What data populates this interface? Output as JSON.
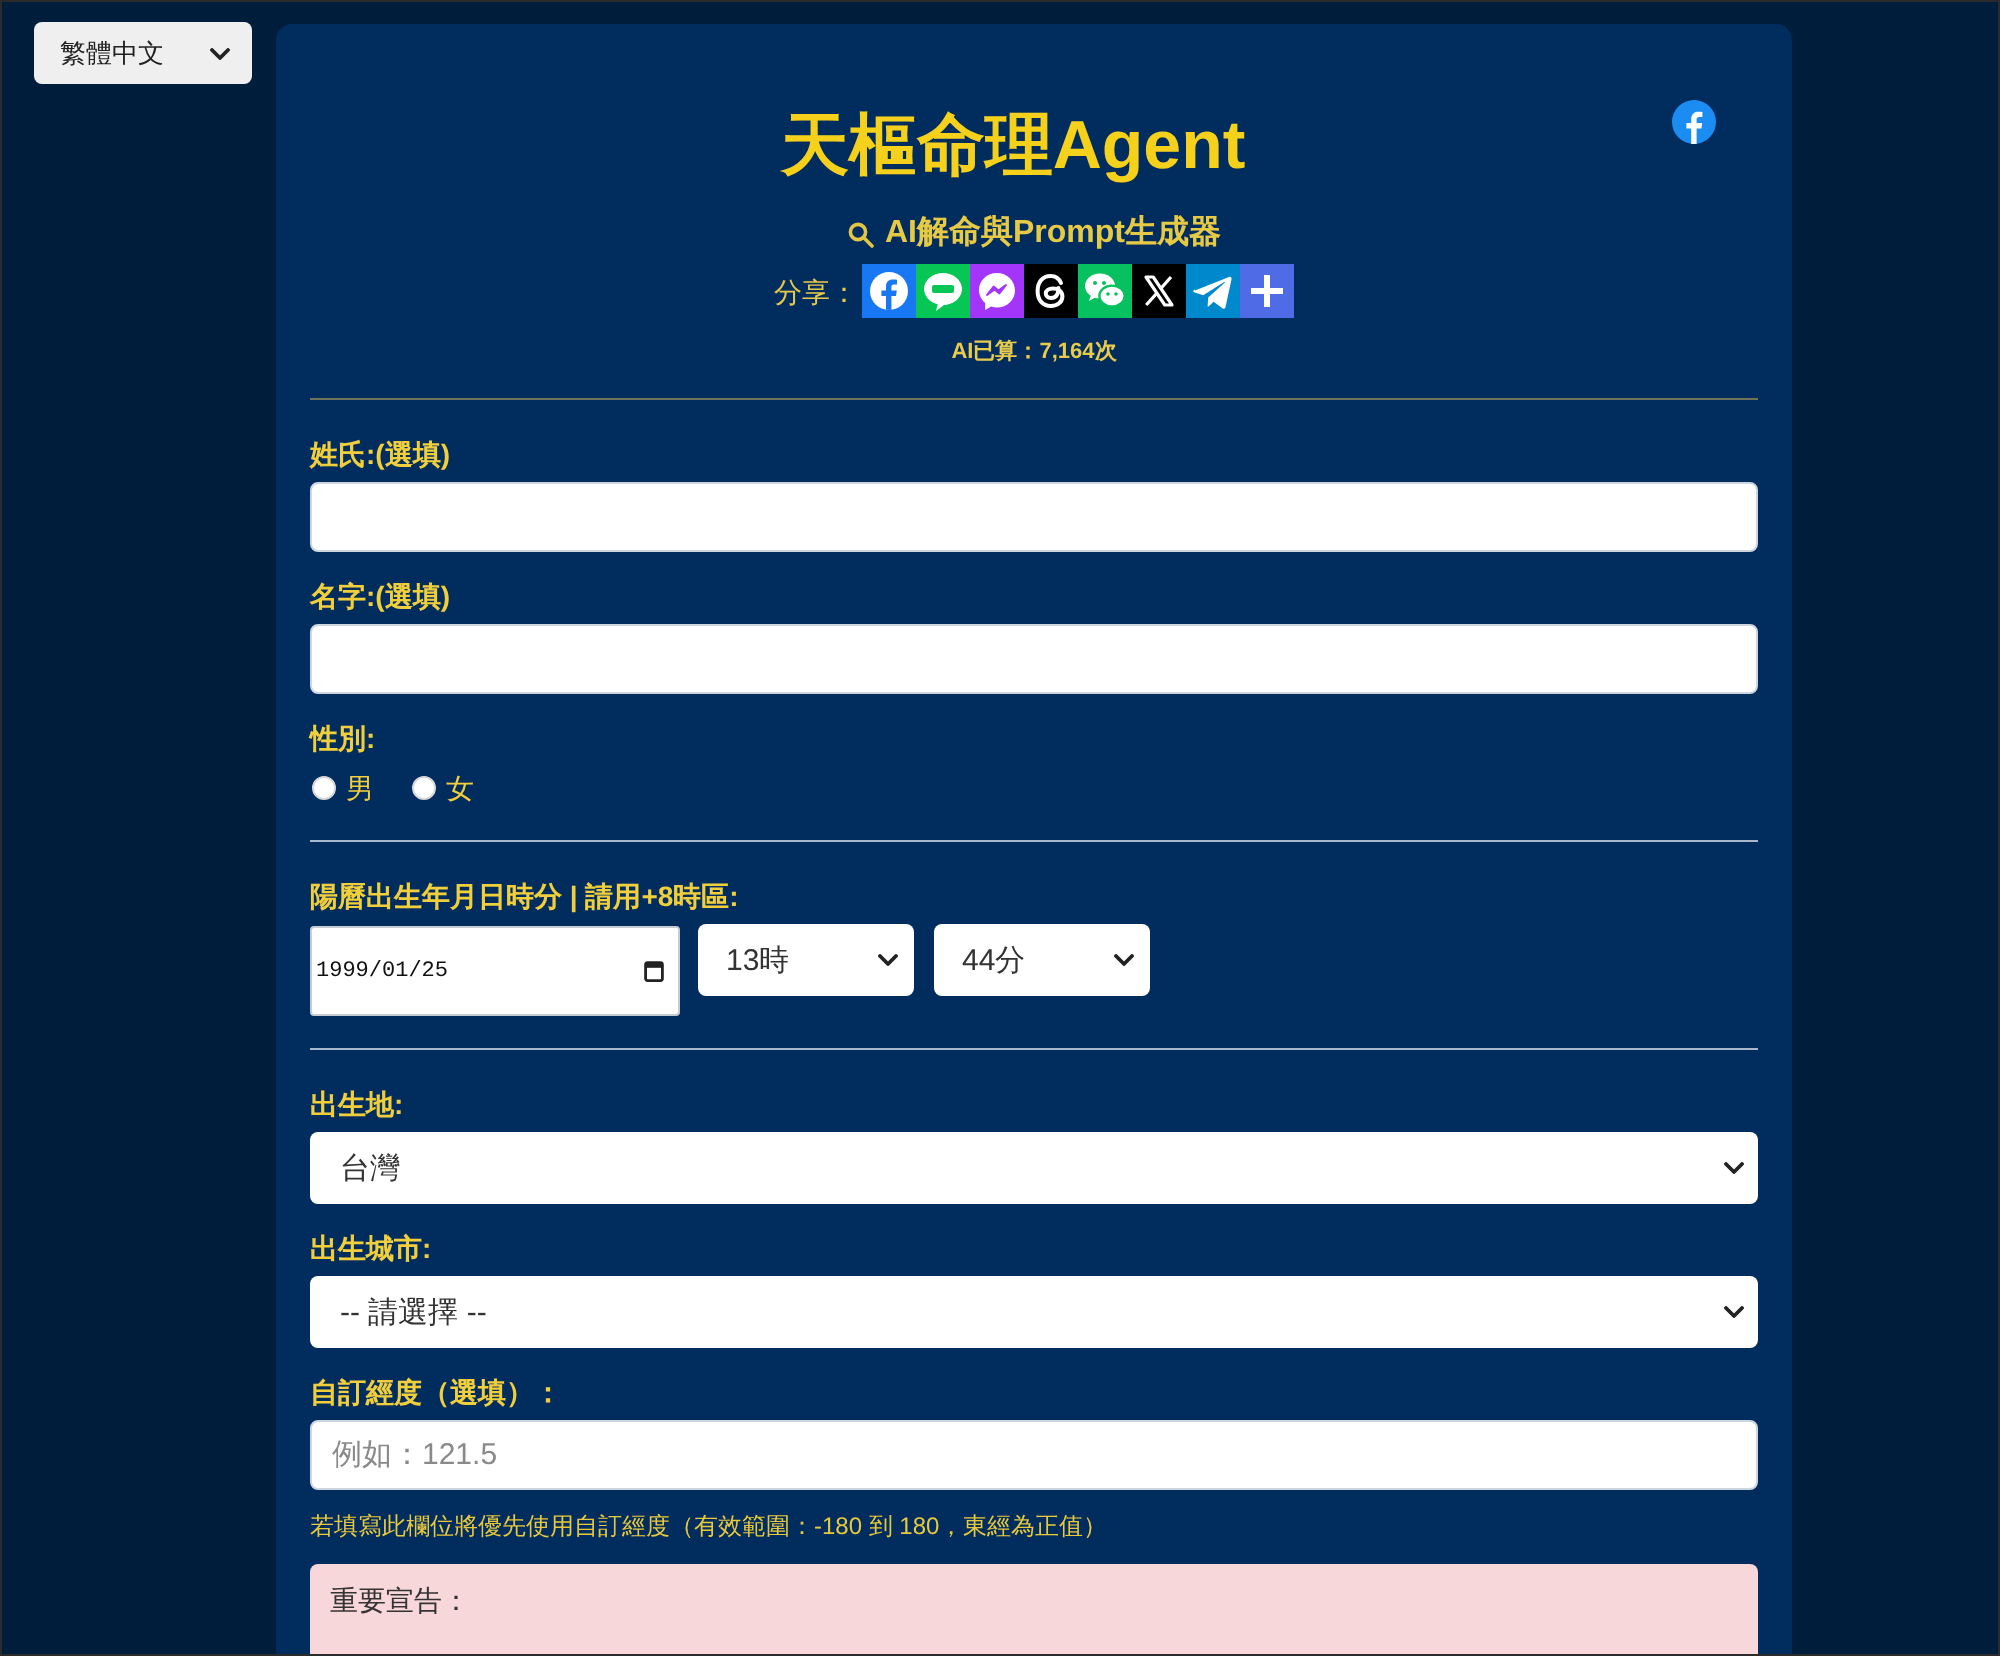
{
  "language_select": {
    "value": "繁體中文"
  },
  "header": {
    "title": "天樞命理Agent",
    "subtitle": "AI解命與Prompt生成器",
    "share_label": "分享：",
    "share_buttons": [
      {
        "kind": "facebook"
      },
      {
        "kind": "line"
      },
      {
        "kind": "messenger"
      },
      {
        "kind": "threads"
      },
      {
        "kind": "wechat"
      },
      {
        "kind": "x"
      },
      {
        "kind": "telegram"
      },
      {
        "kind": "more"
      }
    ],
    "usage_count": "AI已算：7,164次"
  },
  "form": {
    "sections": [
      {
        "fields": [
          {
            "kind": "text",
            "label": "姓氏:(選填)"
          },
          {
            "kind": "text",
            "label": "名字:(選填)"
          },
          {
            "kind": "radio",
            "label": "性別:",
            "options": [
              {
                "label": "男",
                "selected": false
              },
              {
                "label": "女",
                "selected": false
              }
            ]
          }
        ]
      },
      {
        "fields": [
          {
            "kind": "datetime",
            "label": "陽曆出生年月日時分 | 請用+8時區:",
            "date": "1999/01/25",
            "hour": "13時",
            "minute": "44分"
          }
        ]
      },
      {
        "fields": [
          {
            "kind": "select",
            "label": "出生地:",
            "value": "台灣"
          },
          {
            "kind": "select",
            "label": "出生城市:",
            "value": "-- 請選擇 --"
          },
          {
            "kind": "text",
            "label": "自訂經度（選填）：",
            "placeholder": "例如：121.5",
            "hint": "若填寫此欄位將優先使用自訂經度（有效範圍：-180 到 180，東經為正值）"
          }
        ]
      }
    ]
  },
  "notice": {
    "title": "重要宣告："
  }
}
